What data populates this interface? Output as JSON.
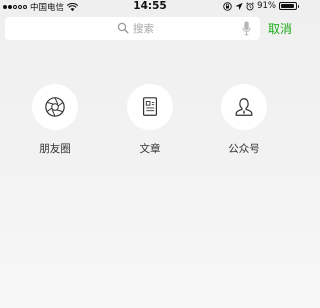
{
  "status_bar": {
    "carrier": "中国电信",
    "time": "14:55",
    "battery": "91%",
    "battery_level": 0.91,
    "signal_bars": 2
  },
  "search": {
    "placeholder": "搜索",
    "cancel_label": "取消",
    "accent_color": "#1aad19"
  },
  "shortcuts": [
    {
      "label": "朋友圈",
      "icon": "moments-aperture-icon"
    },
    {
      "label": "文章",
      "icon": "article-icon"
    },
    {
      "label": "公众号",
      "icon": "official-account-icon"
    }
  ]
}
